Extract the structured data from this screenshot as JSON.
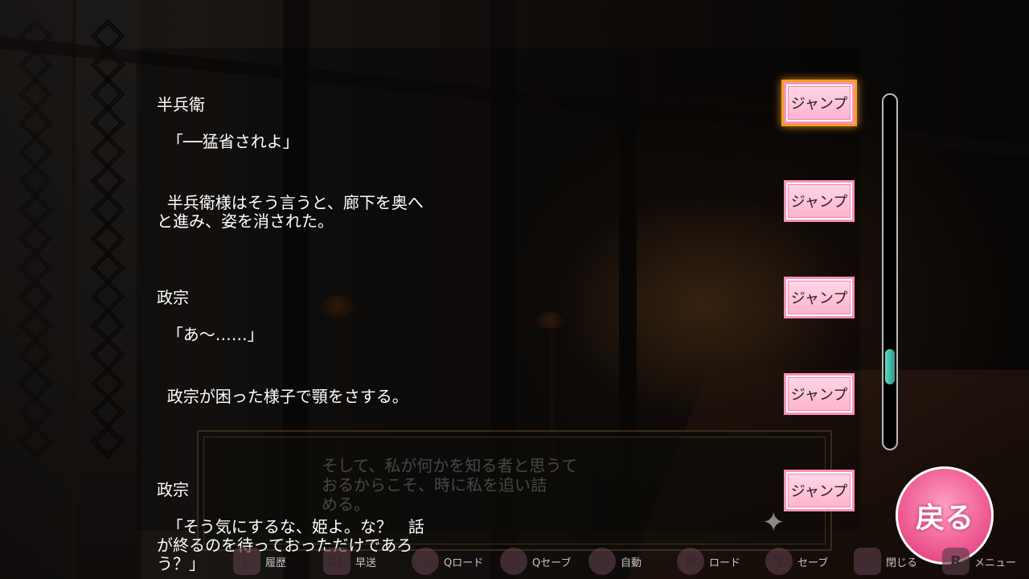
{
  "entries": [
    {
      "name": "半兵衛",
      "text": "「──猛省されよ」",
      "jump": "ジャンプ",
      "focused": true
    },
    {
      "name": "",
      "text": "半兵衛様はそう言うと、廊下を奥へ\nと進み、姿を消された。",
      "jump": "ジャンプ",
      "focused": false
    },
    {
      "name": "政宗",
      "text": "「あ～……」",
      "jump": "ジャンプ",
      "focused": false
    },
    {
      "name": "",
      "text": "政宗が困った様子で顎をさする。",
      "jump": "ジャンプ",
      "focused": false
    },
    {
      "name": "政宗",
      "text": "「そう気にするな、姫よ。な？　話\nが終るのを待っておっただけであろ\nう？」",
      "jump": "ジャンプ",
      "focused": false
    }
  ],
  "message_box": {
    "text": "そして、私が何かを知る者と思うて\nおるからこそ、時に私を追い詰\nめる。"
  },
  "back_button": {
    "label": "戻る"
  },
  "scrollbar": {
    "position": 0.8
  },
  "controls": [
    {
      "key": "L",
      "label": "履歴"
    },
    {
      "key": "ZL",
      "label": "早送"
    },
    {
      "key": "−",
      "label": "Qロード"
    },
    {
      "key": "+",
      "label": "Qセーブ"
    },
    {
      "key": "X",
      "label": "自動"
    },
    {
      "key": "B",
      "label": "ロード"
    },
    {
      "key": "Y",
      "label": "セーブ"
    },
    {
      "key": "ZR",
      "label": "閉じる"
    },
    {
      "key": "R",
      "label": "メニュー"
    }
  ]
}
